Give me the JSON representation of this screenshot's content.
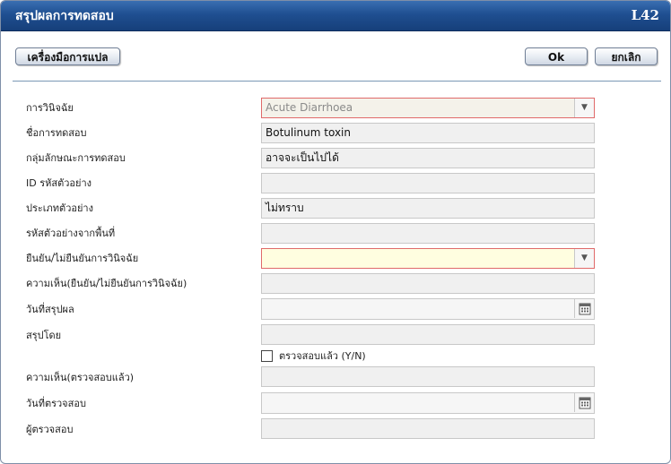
{
  "window": {
    "title": "สรุปผลการทดสอบ",
    "code": "L42"
  },
  "toolbar": {
    "translate_label": "เครื่องมือการแปล",
    "ok_label": "Ok",
    "cancel_label": "ยกเลิก"
  },
  "form": {
    "diagnosis": {
      "label": "การวินิจฉัย",
      "value": "Acute Diarrhoea"
    },
    "test_name": {
      "label": "ชื่อการทดสอบ",
      "value": "Botulinum toxin"
    },
    "test_group": {
      "label": "กลุ่มลักษณะการทดสอบ",
      "value": "อาจจะเป็นไปได้"
    },
    "sample_id": {
      "label": "ID รหัสตัวอย่าง",
      "value": ""
    },
    "sample_type": {
      "label": "ประเภทตัวอย่าง",
      "value": "ไม่ทราบ"
    },
    "local_sample_code": {
      "label": "รหัสตัวอย่างจากพื้นที่",
      "value": ""
    },
    "confirm_diagnosis": {
      "label": "ยืนยัน/ไม่ยืนยันการวินิจฉัย",
      "value": ""
    },
    "confirm_comment": {
      "label": "ความเห็น(ยืนยัน/ไม่ยืนยันการวินิจฉัย)",
      "value": ""
    },
    "summary_date": {
      "label": "วันที่สรุปผล",
      "value": ""
    },
    "summarized_by": {
      "label": "สรุปโดย",
      "value": ""
    },
    "verified": {
      "label": "ตรวจสอบแล้ว (Y/N)",
      "checked": false
    },
    "verify_comment": {
      "label": "ความเห็น(ตรวจสอบแล้ว)",
      "value": ""
    },
    "verify_date": {
      "label": "วันที่ตรวจสอบ",
      "value": ""
    },
    "verifier": {
      "label": "ผู้ตรวจสอบ",
      "value": ""
    }
  },
  "icons": {
    "dropdown": "triangle-down-icon",
    "calendar": "calendar-icon"
  },
  "colors": {
    "title_bar": "#1f4f91",
    "required_border": "#e06a6a",
    "required_fill": "#fffee0",
    "field_fill": "#f0f0f0"
  }
}
